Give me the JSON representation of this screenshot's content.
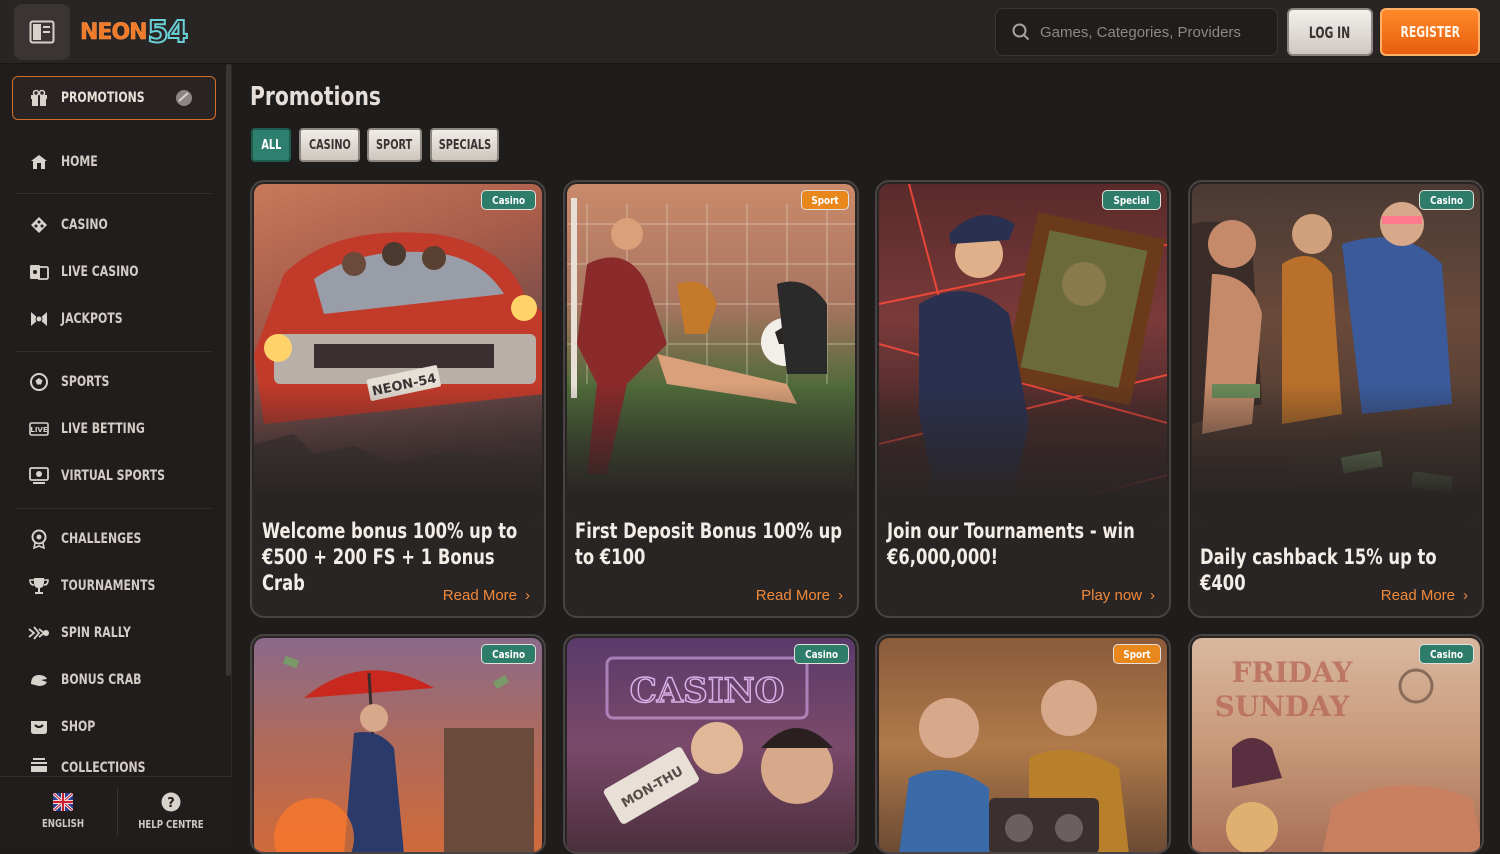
{
  "header": {
    "logo_text": "NEON",
    "logo_number": "54",
    "search_placeholder": "Games, Categories, Providers",
    "login_label": "LOG IN",
    "register_label": "REGISTER"
  },
  "sidebar": {
    "promotions_label": "PROMOTIONS",
    "items": [
      {
        "label": "HOME",
        "icon": "home-icon"
      },
      {
        "label": "CASINO",
        "icon": "casino-icon"
      },
      {
        "label": "LIVE CASINO",
        "icon": "live-casino-icon"
      },
      {
        "label": "JACKPOTS",
        "icon": "jackpots-icon"
      },
      {
        "label": "SPORTS",
        "icon": "sports-ball-icon"
      },
      {
        "label": "LIVE BETTING",
        "icon": "live-betting-icon"
      },
      {
        "label": "VIRTUAL SPORTS",
        "icon": "virtual-sports-icon"
      },
      {
        "label": "CHALLENGES",
        "icon": "challenges-icon"
      },
      {
        "label": "TOURNAMENTS",
        "icon": "trophy-icon"
      },
      {
        "label": "SPIN RALLY",
        "icon": "spin-rally-icon"
      },
      {
        "label": "BONUS CRAB",
        "icon": "crab-icon"
      },
      {
        "label": "SHOP",
        "icon": "shop-icon"
      },
      {
        "label": "COLLECTIONS",
        "icon": "collections-icon"
      }
    ],
    "footer": {
      "language_label": "ENGLISH",
      "help_label": "HELP CENTRE"
    }
  },
  "main": {
    "title": "Promotions",
    "filters": [
      "ALL",
      "CASINO",
      "SPORT",
      "SPECIALS"
    ],
    "active_filter": "ALL",
    "cards": [
      {
        "badge": "Casino",
        "title": "Welcome bonus 100% up to €500 + 200 FS + 1 Bonus Crab",
        "link": "Read More"
      },
      {
        "badge": "Sport",
        "title": "First Deposit Bonus 100% up to €100",
        "link": "Read More"
      },
      {
        "badge": "Special",
        "title": "Join our Tournaments - win €6,000,000!",
        "link": "Play now"
      },
      {
        "badge": "Casino",
        "title": "Daily cashback 15% up to €400",
        "link": "Read More"
      },
      {
        "badge": "Casino",
        "title": "",
        "link": ""
      },
      {
        "badge": "Casino",
        "title": "",
        "link": ""
      },
      {
        "badge": "Sport",
        "title": "",
        "link": ""
      },
      {
        "badge": "Casino",
        "title": "",
        "link": ""
      }
    ],
    "art_text": {
      "car_plate": "NEON-54",
      "casino_sign": "CASINO",
      "ticket": "MON-THU",
      "friday": "FRIDAY",
      "sunday": "SUNDAY"
    }
  },
  "colors": {
    "accent": "#f07a2a",
    "teal": "#2f7f6e",
    "background": "#1f1c1c"
  }
}
